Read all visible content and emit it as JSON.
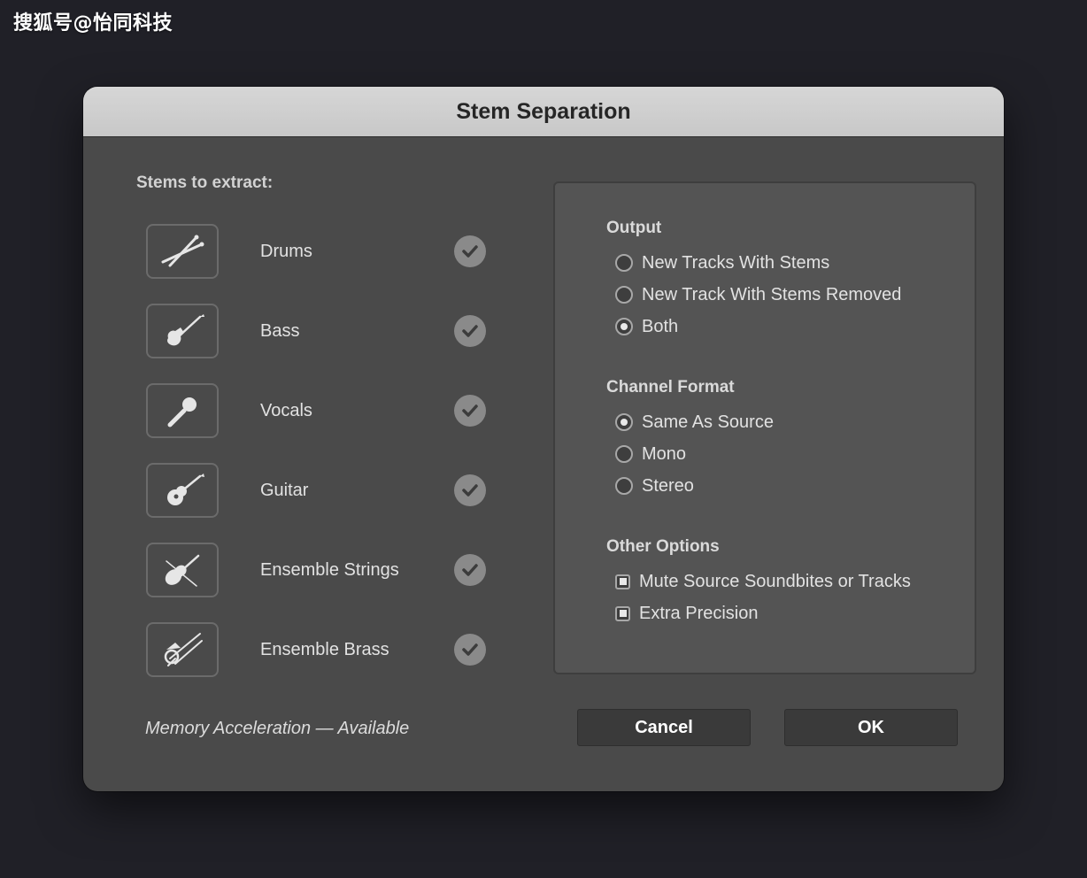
{
  "watermark": "搜狐号@怡同科技",
  "dialog": {
    "title": "Stem Separation",
    "stems_heading": "Stems to extract:",
    "stems": [
      {
        "label": "Drums",
        "icon": "drumsticks-icon",
        "checked": true
      },
      {
        "label": "Bass",
        "icon": "bass-guitar-icon",
        "checked": true
      },
      {
        "label": "Vocals",
        "icon": "microphone-icon",
        "checked": true
      },
      {
        "label": "Guitar",
        "icon": "acoustic-guitar-icon",
        "checked": true
      },
      {
        "label": "Ensemble Strings",
        "icon": "violin-icon",
        "checked": true
      },
      {
        "label": "Ensemble Brass",
        "icon": "trombone-icon",
        "checked": true
      }
    ],
    "output": {
      "heading": "Output",
      "options": [
        {
          "label": "New Tracks With Stems",
          "selected": false
        },
        {
          "label": "New Track With Stems Removed",
          "selected": false
        },
        {
          "label": "Both",
          "selected": true
        }
      ]
    },
    "channel_format": {
      "heading": "Channel Format",
      "options": [
        {
          "label": "Same As Source",
          "selected": true
        },
        {
          "label": "Mono",
          "selected": false
        },
        {
          "label": "Stereo",
          "selected": false
        }
      ]
    },
    "other_options": {
      "heading": "Other Options",
      "options": [
        {
          "label": "Mute Source Soundbites or Tracks",
          "checked": true
        },
        {
          "label": "Extra Precision",
          "checked": true
        }
      ]
    },
    "memory_note": "Memory Acceleration —  Available",
    "buttons": {
      "cancel": "Cancel",
      "ok": "OK"
    }
  },
  "colors": {
    "background": "#202027",
    "dialog_body": "#4a4a4a",
    "titlebar": "#d0d0d0",
    "panel": "#545454",
    "check_badge": "#8a8a8a",
    "button": "#3a3a3a"
  }
}
